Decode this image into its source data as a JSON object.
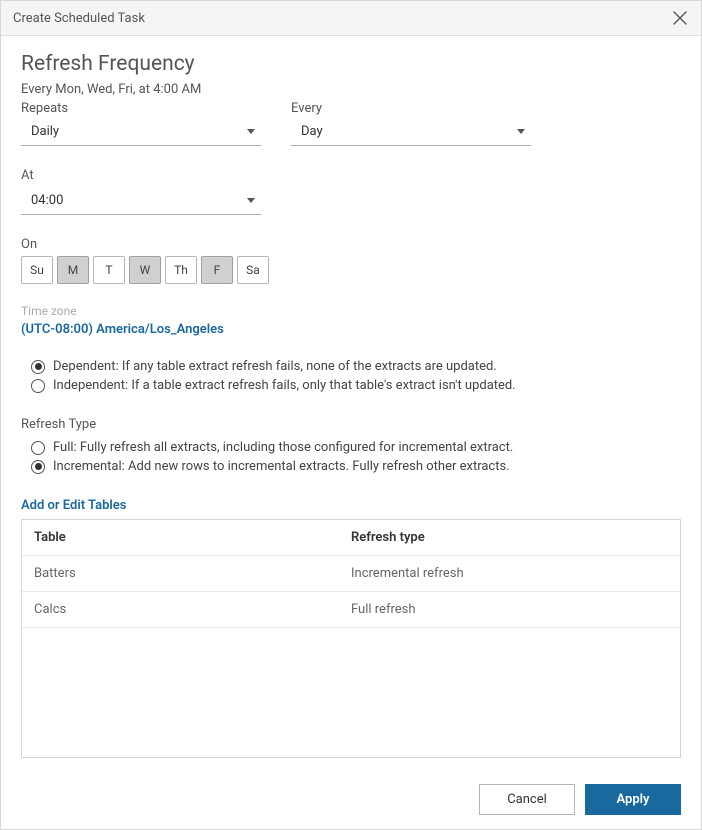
{
  "dialog": {
    "title": "Create Scheduled Task"
  },
  "heading": "Refresh Frequency",
  "summary": "Every Mon, Wed, Fri, at 4:00 AM",
  "repeats": {
    "label": "Repeats",
    "value": "Daily"
  },
  "every": {
    "label": "Every",
    "value": "Day"
  },
  "at": {
    "label": "At",
    "value": "04:00"
  },
  "on": {
    "label": "On",
    "days": [
      {
        "abbr": "Su",
        "selected": false
      },
      {
        "abbr": "M",
        "selected": true
      },
      {
        "abbr": "T",
        "selected": false
      },
      {
        "abbr": "W",
        "selected": true
      },
      {
        "abbr": "Th",
        "selected": false
      },
      {
        "abbr": "F",
        "selected": true
      },
      {
        "abbr": "Sa",
        "selected": false
      }
    ]
  },
  "timezone": {
    "label": "Time zone",
    "value": "(UTC-08:00) America/Los_Angeles"
  },
  "dependency": {
    "options": [
      {
        "text": "Dependent: If any table extract refresh fails, none of the extracts are updated.",
        "checked": true
      },
      {
        "text": "Independent: If a table extract refresh fails, only that table's extract isn't updated.",
        "checked": false
      }
    ]
  },
  "refresh_type": {
    "label": "Refresh Type",
    "options": [
      {
        "text": "Full: Fully refresh all extracts, including those configured for incremental extract.",
        "checked": false
      },
      {
        "text": "Incremental: Add new rows to incremental extracts. Fully refresh other extracts.",
        "checked": true
      }
    ]
  },
  "add_edit_tables": "Add or Edit Tables",
  "table": {
    "col1": "Table",
    "col2": "Refresh type",
    "rows": [
      {
        "c1": "Batters",
        "c2": "Incremental refresh"
      },
      {
        "c1": "Calcs",
        "c2": "Full refresh"
      }
    ]
  },
  "footer": {
    "cancel": "Cancel",
    "apply": "Apply"
  }
}
